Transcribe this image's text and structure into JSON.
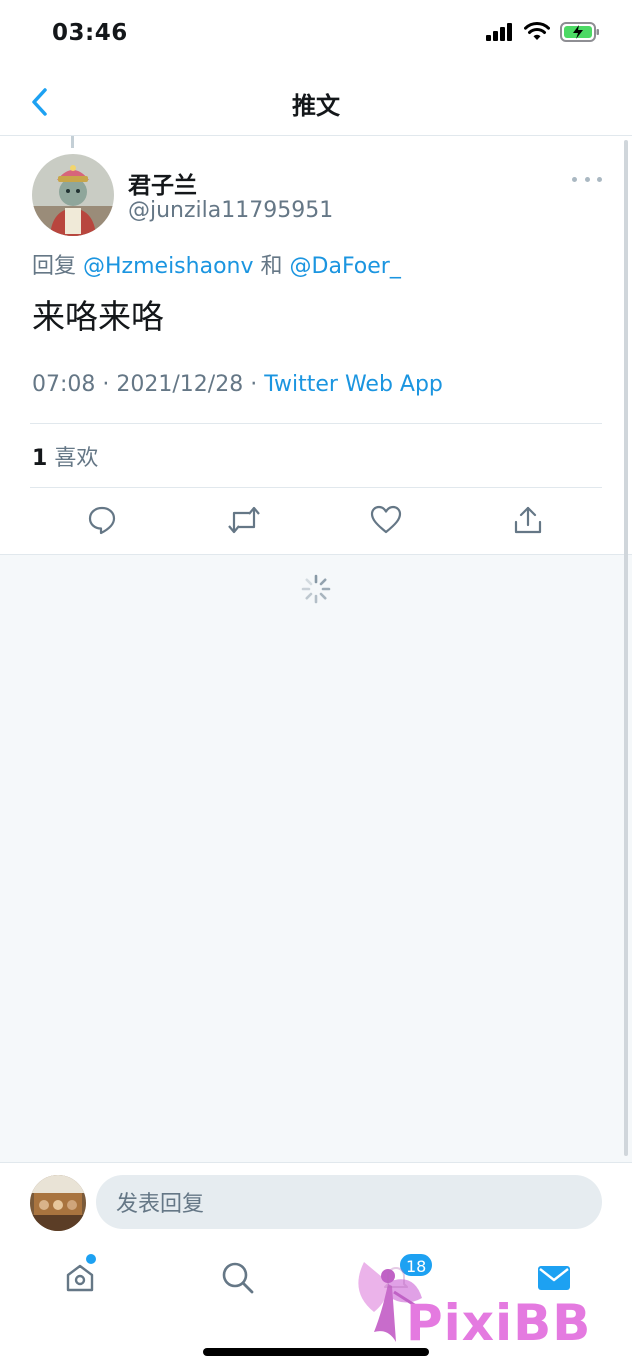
{
  "status_bar": {
    "time": "03:46",
    "icons": [
      "cellular-signal-icon",
      "wifi-icon",
      "battery-charging-icon"
    ]
  },
  "nav": {
    "back_icon": "chevron-left-icon",
    "title": "推文"
  },
  "tweet": {
    "display_name": "君子兰",
    "handle": "@junzila11795951",
    "reply_prefix": "回复",
    "mention_1": "@Hzmeishaonv",
    "reply_joiner": "和",
    "mention_2": "@DaFoer_",
    "text": "来咯来咯",
    "time": "07:08",
    "separator": "·",
    "date": "2021/12/28",
    "source": "Twitter Web App",
    "like_count": "1",
    "like_label": "喜欢",
    "action_icons": [
      "reply-icon",
      "retweet-icon",
      "like-icon",
      "share-icon"
    ]
  },
  "reply_bar": {
    "placeholder": "发表回复"
  },
  "tab_bar": {
    "tabs": [
      "home-icon",
      "search-icon",
      "notifications-icon",
      "messages-icon"
    ],
    "notification_badge": "18"
  },
  "watermark": {
    "text": "PixiBB"
  },
  "colors": {
    "accent": "#1da1f2",
    "link": "#1b95e0",
    "secondary_text": "#657786",
    "background_gray": "#f5f8fa"
  }
}
